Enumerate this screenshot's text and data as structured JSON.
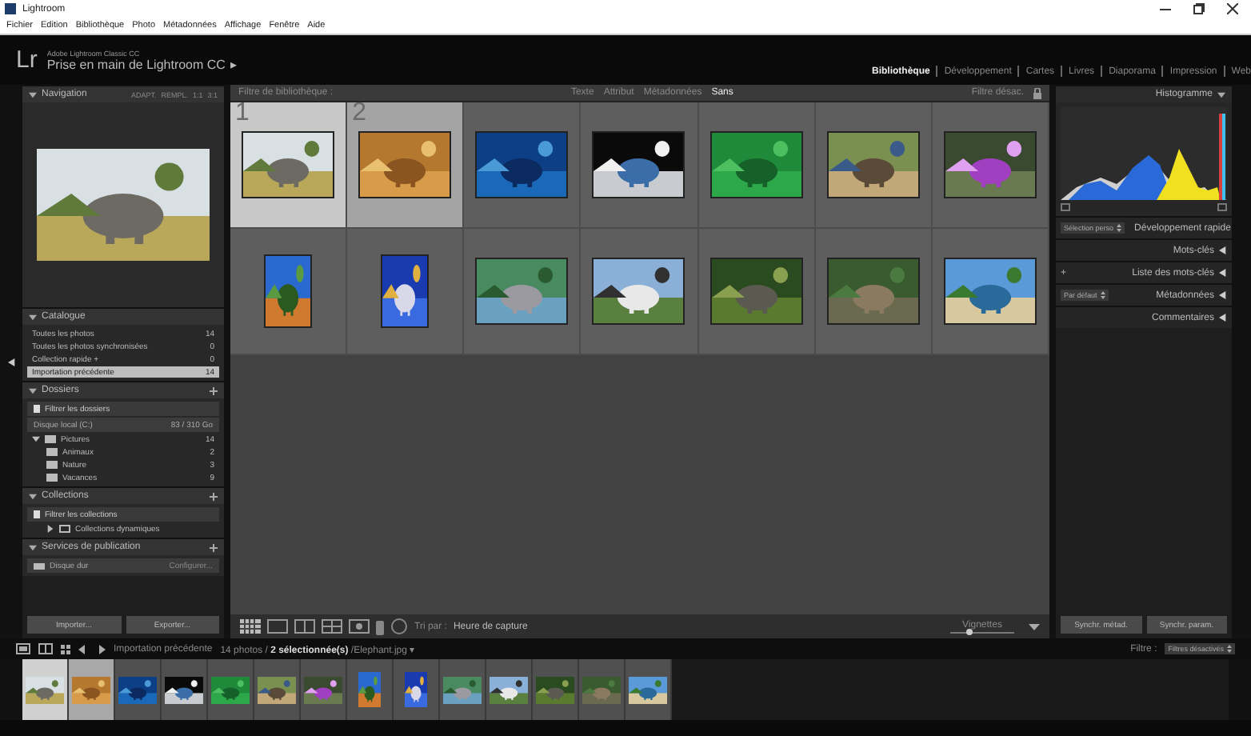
{
  "app_title": "Lightroom",
  "menu": [
    "Fichier",
    "Edition",
    "Bibliothèque",
    "Photo",
    "Métadonnées",
    "Affichage",
    "Fenêtre",
    "Aide"
  ],
  "identity": {
    "logo": "Lr",
    "product": "Adobe Lightroom Classic CC",
    "catalog": "Prise en main de Lightroom CC",
    "catalog_arrow": "▸"
  },
  "modules": [
    {
      "label": "Bibliothèque",
      "selected": true
    },
    {
      "label": "Développement",
      "selected": false
    },
    {
      "label": "Cartes",
      "selected": false
    },
    {
      "label": "Livres",
      "selected": false
    },
    {
      "label": "Diaporama",
      "selected": false
    },
    {
      "label": "Impression",
      "selected": false
    },
    {
      "label": "Web",
      "selected": false
    }
  ],
  "left_panel": {
    "navigation": {
      "title": "Navigation",
      "zoom_options": [
        "ADAPT.",
        "REMPL.",
        "1:1",
        "3:1"
      ]
    },
    "catalogue": {
      "title": "Catalogue",
      "items": [
        {
          "label": "Toutes les photos",
          "count": "14",
          "selected": false
        },
        {
          "label": "Toutes les photos synchronisées",
          "count": "0",
          "selected": false
        },
        {
          "label": "Collection rapide +",
          "count": "0",
          "selected": false
        },
        {
          "label": "Importation précédente",
          "count": "14",
          "selected": true
        }
      ]
    },
    "folders": {
      "title": "Dossiers",
      "filter": "Filtrer les dossiers",
      "volume": "Disque local (C:)",
      "volume_space": "83 / 310 Go",
      "tree": [
        {
          "label": "Pictures",
          "count": "14",
          "expanded": true,
          "children": [
            {
              "label": "Animaux",
              "count": "2"
            },
            {
              "label": "Nature",
              "count": "3"
            },
            {
              "label": "Vacances",
              "count": "9"
            }
          ]
        }
      ]
    },
    "collections": {
      "title": "Collections",
      "filter": "Filtrer les collections",
      "items": [
        {
          "label": "Collections dynamiques",
          "expanded": false
        }
      ]
    },
    "publish": {
      "title": "Services de publication",
      "service": "Disque dur",
      "action": "Configurer..."
    },
    "buttons": [
      "Importer...",
      "Exporter..."
    ]
  },
  "filter_bar": {
    "label": "Filtre de bibliothèque :",
    "options": [
      {
        "label": "Texte",
        "selected": false
      },
      {
        "label": "Attribut",
        "selected": false
      },
      {
        "label": "Métadonnées",
        "selected": false
      },
      {
        "label": "Sans",
        "selected": true
      }
    ],
    "preset": "Filtre désac."
  },
  "grid": {
    "items": [
      {
        "number": "1",
        "selected": true
      },
      {
        "number": "2",
        "selected": true
      },
      {
        "selected": false
      },
      {
        "selected": false
      },
      {
        "selected": false
      },
      {
        "selected": false
      },
      {
        "selected": false
      },
      {
        "selected": false
      },
      {
        "selected": false
      },
      {
        "selected": false
      },
      {
        "selected": false
      },
      {
        "selected": false
      },
      {
        "selected": false
      },
      {
        "selected": false
      }
    ]
  },
  "toolbar": {
    "sort_label": "Tri par :",
    "sort_value": "Heure de capture",
    "thumbnails_label": "Vignettes",
    "level": 0.3
  },
  "right_panel": {
    "histogram_title": "Histogramme",
    "sections": [
      {
        "label": "Développement rapide",
        "kind": "dropdown",
        "control": "Sélection perso"
      },
      {
        "label": "Mots-clés",
        "kind": "plain"
      },
      {
        "label": "Liste des mots-clés",
        "kind": "button",
        "control": "+"
      },
      {
        "label": "Métadonnées",
        "kind": "dropdown",
        "control": "Par défaut"
      },
      {
        "label": "Commentaires",
        "kind": "plain"
      }
    ],
    "buttons": [
      "Synchr. métad.",
      "Synchr. param."
    ]
  },
  "filmstrip": {
    "source": "Importation précédente",
    "summary": "14 photos / **2 sélectionnée(s)** /Elephant.jpg ▾",
    "filter_label": "Filtre :",
    "filter_value": "Filtres désactivés",
    "items": [
      {
        "selected": true
      },
      {
        "selected": true
      },
      {
        "selected": false
      },
      {
        "selected": false
      },
      {
        "selected": false
      },
      {
        "selected": false
      },
      {
        "selected": false
      },
      {
        "selected": false
      },
      {
        "selected": false
      },
      {
        "selected": false
      },
      {
        "selected": false
      },
      {
        "selected": false
      },
      {
        "selected": false
      },
      {
        "selected": false
      }
    ]
  }
}
